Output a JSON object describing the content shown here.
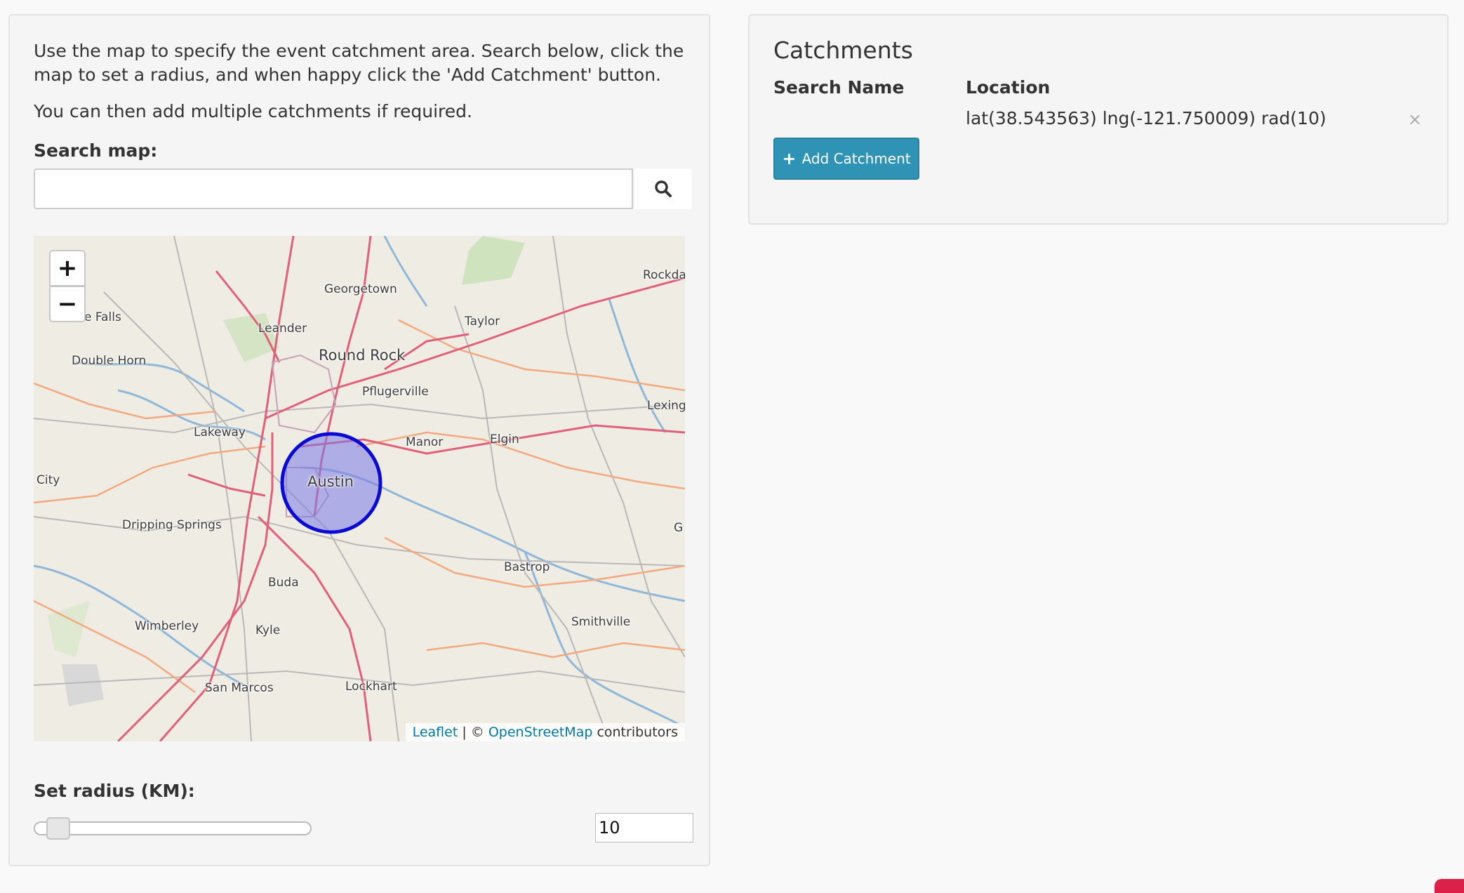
{
  "intro": {
    "line1": "Use the map to specify the event catchment area. Search below, click the",
    "line2": "map to set a radius, and when happy click the 'Add Catchment' button.",
    "line3": "You can then add multiple catchments if required."
  },
  "search": {
    "label": "Search map:",
    "value": "",
    "placeholder": ""
  },
  "map": {
    "zoom_in": "+",
    "zoom_out": "−",
    "places": [
      "Georgetown",
      "Rockda",
      "e Falls",
      "Leander",
      "Taylor",
      "Double Horn",
      "Round Rock",
      "Pflugerville",
      "Lexingto",
      "Lakeway",
      "Manor",
      "Elgin",
      "Austin",
      "City",
      "Dripping Springs",
      "G",
      "Bastrop",
      "Buda",
      "Smithville",
      "Wimberley",
      "Kyle",
      "San Marcos",
      "Lockhart"
    ],
    "attribution": {
      "leaflet": "Leaflet",
      "separator": " | © ",
      "osm": "OpenStreetMap",
      "suffix": " contributors"
    },
    "colors": {
      "circle_fill": "#7a7ae8",
      "circle_stroke": "#0a0ad6",
      "major_road": "#e0607a",
      "minor_road": "#9a9a9a",
      "water": "#8fb8d8"
    }
  },
  "radius": {
    "label": "Set radius (KM):",
    "value": "10",
    "slider_fraction": 0.05
  },
  "catchments": {
    "title": "Catchments",
    "col_name": "Search Name",
    "col_location": "Location",
    "rows": [
      {
        "name": "",
        "location": "lat(38.543563) lng(-121.750009) rad(10)",
        "remove_icon": "×"
      }
    ],
    "add_label": "Add Catchment",
    "add_icon": "+"
  },
  "theme": {
    "accent": "#2e93b5",
    "link": "#0078a8",
    "badge": "#dc2148"
  }
}
